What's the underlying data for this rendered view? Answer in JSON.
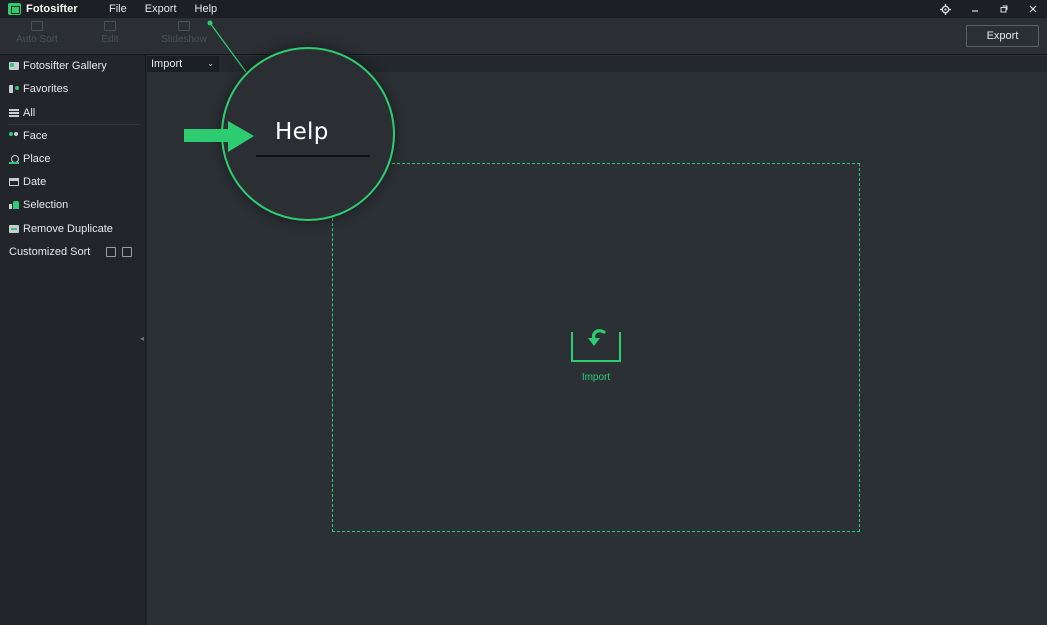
{
  "app": {
    "name": "Fotosifter"
  },
  "menu": [
    "File",
    "Export",
    "Help"
  ],
  "window_controls": [
    "settings-icon",
    "minimize-icon",
    "restore-icon",
    "close-icon"
  ],
  "toolbar": {
    "auto_sort": "Auto Sort",
    "edit": "Edit",
    "slideshow": "Slideshow",
    "export": "Export"
  },
  "sidebar": {
    "items": [
      {
        "label": "Fotosifter Gallery",
        "icon": "gallery-icon"
      },
      {
        "label": "Favorites",
        "icon": "favorites-icon"
      },
      {
        "label": "All",
        "icon": "list-icon"
      },
      {
        "label": "Face",
        "icon": "face-icon"
      },
      {
        "label": "Place",
        "icon": "place-icon"
      },
      {
        "label": "Date",
        "icon": "calendar-icon"
      },
      {
        "label": "Selection",
        "icon": "thumbs-up-icon"
      },
      {
        "label": "Remove Duplicate",
        "icon": "duplicate-icon"
      }
    ],
    "customized_sort": "Customized Sort"
  },
  "main": {
    "import_select": "Import",
    "dropzone_label": "Import"
  },
  "callout": {
    "text": "Help"
  },
  "colors": {
    "accent": "#2ecc71",
    "background": "#2b3035",
    "sidebar": "#22262a",
    "titlebar": "#1c1f23"
  }
}
